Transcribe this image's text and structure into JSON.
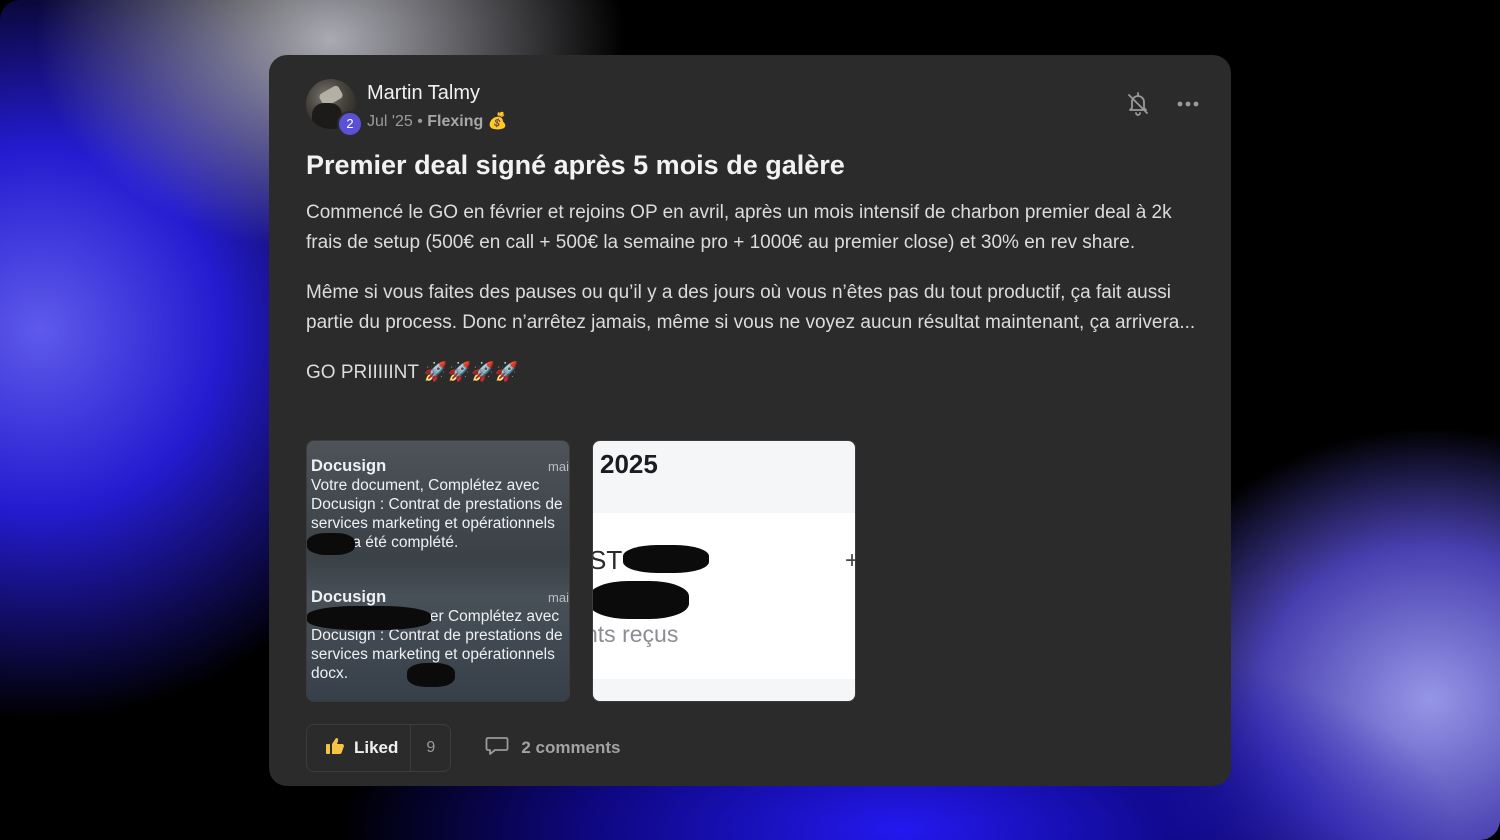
{
  "post": {
    "author": "Martin Talmy",
    "level": "2",
    "date": "Jul '25",
    "separator": "•",
    "category": "Flexing",
    "category_emoji": "💰",
    "title": "Premier deal signé après 5 mois de galère",
    "paragraphs": [
      "Commencé le GO en février et rejoins OP en avril, après un mois intensif de charbon premier deal à 2k frais de setup (500€ en call + 500€ la semaine pro + 1000€ au premier close) et 30% en rev share.",
      "Même si vous faites des pauses ou qu’il y a des jours où vous n’êtes pas du tout productif, ça fait aussi partie du process. Donc n’arrêtez jamais, même si vous ne voyez aucun résultat maintenant, ça arrivera...",
      "GO PRIIIIINT 🚀🚀🚀🚀"
    ]
  },
  "images": {
    "image1": {
      "notifications": [
        {
          "app": "Docusign",
          "time": "mai",
          "text": "Votre document, Complétez avec Docusign : Contrat de prestations de services marketing et opérationnels docx, a été complété."
        },
        {
          "app": "Docusign",
          "time": "mai",
          "text": "a terminé de signer Complétez avec Docusign : Contrat de prestations de services marketing et opérationnels docx."
        }
      ]
    },
    "image2": {
      "year": "2025",
      "partial_label": "ST",
      "plus": "+",
      "received": "nts reçus"
    }
  },
  "actions": {
    "like_label": "Liked",
    "like_count": "9",
    "comments_label": "2 comments"
  },
  "icons": {
    "bell": "bell-off-icon",
    "more": "more-horizontal-icon",
    "like": "thumbs-up-icon",
    "comment": "comment-icon"
  },
  "colors": {
    "card": "#2b2b2b",
    "level_badge": "#5a51d6",
    "like_icon": "#f5c542"
  }
}
